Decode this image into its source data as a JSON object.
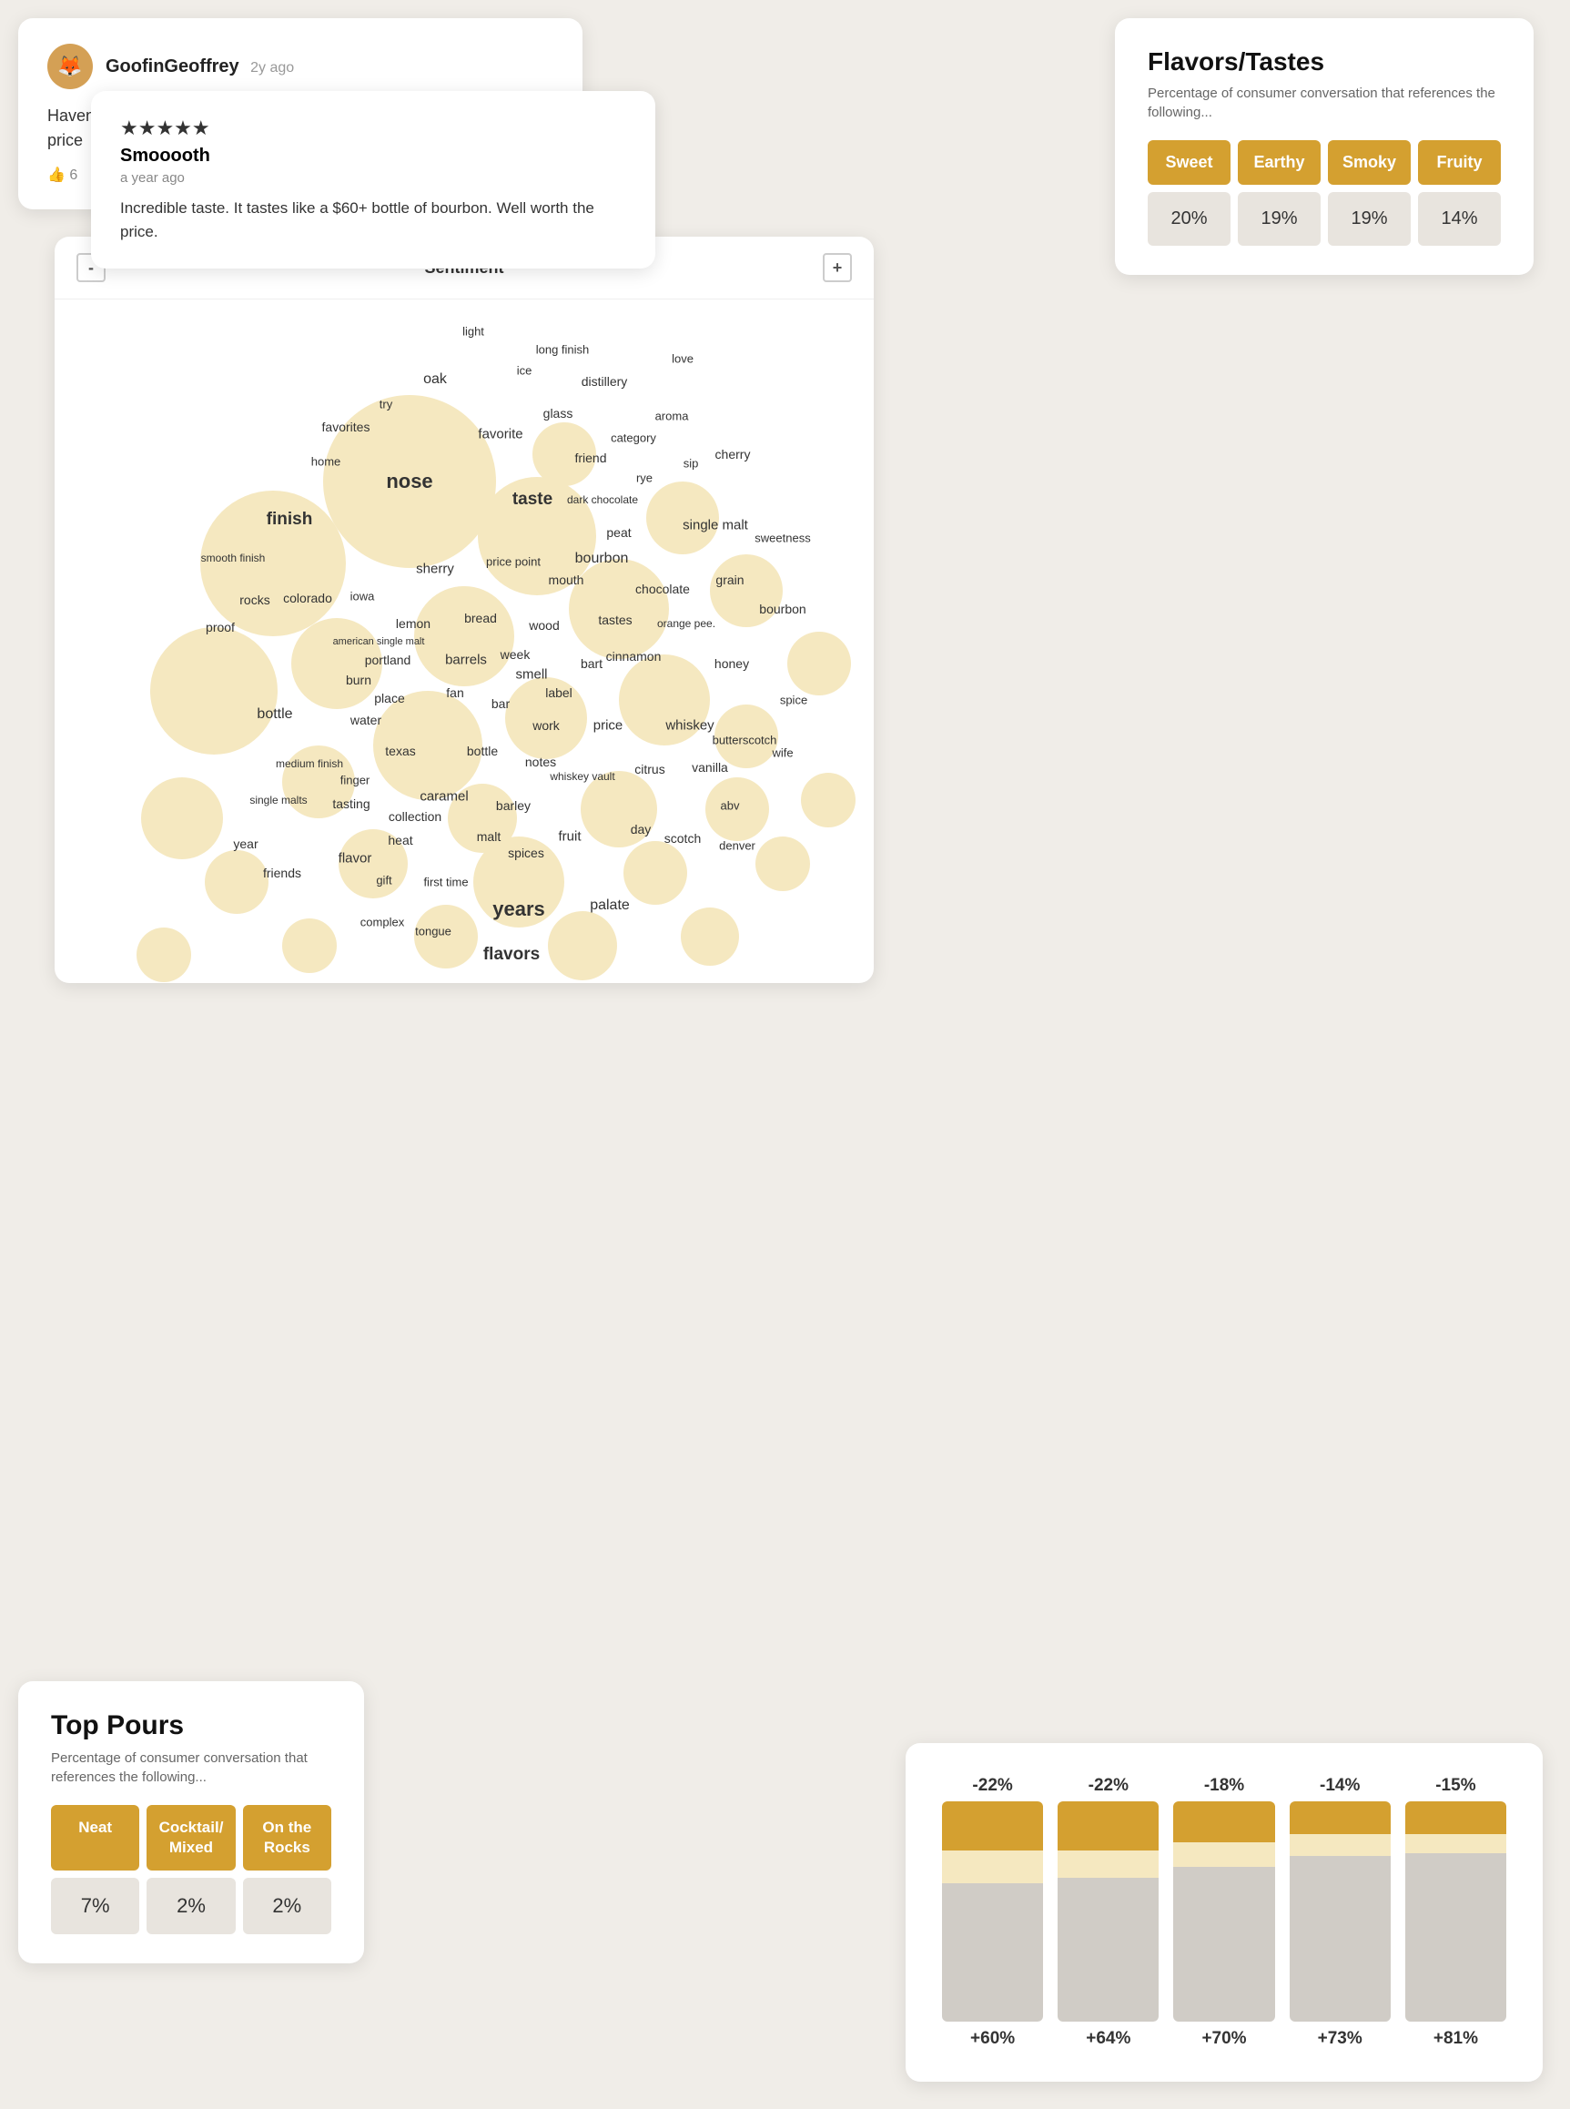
{
  "review1": {
    "username": "GoofinGeoffrey",
    "time": "2y ago",
    "avatar_emoji": "🦊",
    "text": "Haven't had this one but their peated is actually pretty decent at it's price",
    "likes": "6"
  },
  "review2": {
    "stars": "★★★★★",
    "title": "Smooooth",
    "date": "a year ago",
    "body": "Incredible taste. It tastes like a $60+ bottle of bourbon. Well worth the price."
  },
  "flavors": {
    "title": "Flavors/Tastes",
    "subtitle": "Percentage of consumer conversation that references the following...",
    "items": [
      {
        "label": "Sweet",
        "value": "20%"
      },
      {
        "label": "Earthy",
        "value": "19%"
      },
      {
        "label": "Smoky",
        "value": "19%"
      },
      {
        "label": "Fruity",
        "value": "14%"
      }
    ]
  },
  "sentiment": {
    "minus": "-",
    "label": "Sentiment",
    "plus": "+"
  },
  "wordcloud": {
    "words": [
      "light",
      "long finish",
      "ice",
      "oak",
      "distillery",
      "love",
      "try",
      "favorites",
      "glass",
      "favorite",
      "aroma",
      "category",
      "home",
      "friend",
      "nose",
      "taste",
      "dark chocolate",
      "sip",
      "cherry",
      "rye",
      "finish",
      "peat",
      "single malt",
      "sweetness",
      "smooth finish",
      "sherry",
      "price point",
      "mouth",
      "bourbon",
      "rocks",
      "colorado",
      "iowa",
      "chocolate",
      "grain",
      "proof",
      "lemon",
      "bread",
      "wood",
      "tastes",
      "orange pee.",
      "american single malt",
      "portland",
      "burn",
      "barrels",
      "week",
      "smell",
      "bart",
      "cinnamon",
      "honey",
      "place",
      "fan",
      "bar",
      "label",
      "bottle",
      "water",
      "work",
      "price",
      "whiskey",
      "wife",
      "texas",
      "notes",
      "whiskey vault",
      "citrus",
      "vanilla",
      "butterscotch",
      "medium finish",
      "finger",
      "caramel",
      "barley",
      "abv",
      "single malts",
      "tasting",
      "collection",
      "heat",
      "malt",
      "spices",
      "scotch",
      "denver",
      "year",
      "fruit",
      "day",
      "friends",
      "flavor",
      "gift",
      "first time",
      "years",
      "palate",
      "complex",
      "tongue",
      "flavors"
    ]
  },
  "top_pours": {
    "title": "Top Pours",
    "subtitle": "Percentage of consumer conversation that references the following...",
    "headers": [
      "Neat",
      "Cocktail/ Mixed",
      "On the Rocks"
    ],
    "values": [
      "7%",
      "2%",
      "2%"
    ]
  },
  "bar_chart": {
    "bars": [
      {
        "negative": "-22%",
        "positive": "+60%",
        "top_h": 18,
        "mid_h": 12
      },
      {
        "negative": "-22%",
        "positive": "+64%",
        "top_h": 18,
        "mid_h": 10
      },
      {
        "negative": "-18%",
        "positive": "+70%",
        "top_h": 15,
        "mid_h": 9
      },
      {
        "negative": "-14%",
        "positive": "+73%",
        "top_h": 12,
        "mid_h": 8
      },
      {
        "negative": "-15%",
        "positive": "+81%",
        "top_h": 12,
        "mid_h": 7
      }
    ]
  }
}
